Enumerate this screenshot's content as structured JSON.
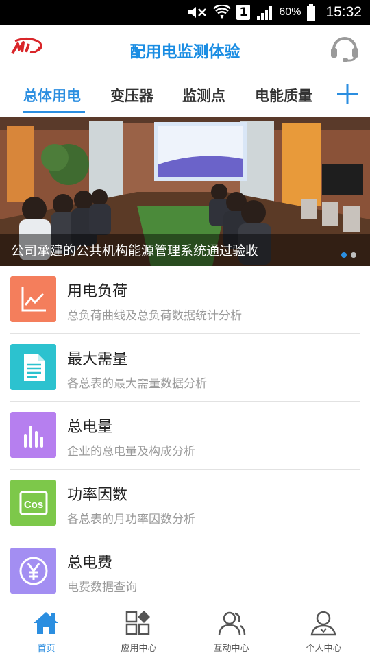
{
  "status_bar": {
    "battery_text": "60%",
    "time": "15:32",
    "sim_label": "1",
    "icons": [
      "mute-icon",
      "wifi-icon",
      "sim-icon",
      "signal-icon",
      "battery-icon"
    ]
  },
  "header": {
    "title": "配用电监测体验",
    "logo_icon": "app-logo-icon",
    "service_icon": "customer-service-headset-icon"
  },
  "tabs": {
    "items": [
      {
        "label": "总体用电",
        "active": true
      },
      {
        "label": "变压器",
        "active": false
      },
      {
        "label": "监测点",
        "active": false
      },
      {
        "label": "电能质量",
        "active": false
      }
    ],
    "add_icon": "plus-icon"
  },
  "banner": {
    "caption": "公司承建的公共机构能源管理系统通过验收",
    "slide_count": 2,
    "active_slide": 1
  },
  "list": {
    "items": [
      {
        "title": "用电负荷",
        "desc": "总负荷曲线及总负荷数据统计分析",
        "icon": "line-chart-icon",
        "color": "#f47e5c"
      },
      {
        "title": "最大需量",
        "desc": "各总表的最大需量数据分析",
        "icon": "document-icon",
        "color": "#2cc2cf"
      },
      {
        "title": "总电量",
        "desc": "企业的总电量及构成分析",
        "icon": "bar-chart-icon",
        "color": "#b67fef"
      },
      {
        "title": "功率因数",
        "desc": "各总表的月功率因数分析",
        "icon": "cos-icon",
        "color": "#7dc84a"
      },
      {
        "title": "总电费",
        "desc": "电费数据查询",
        "icon": "yen-icon",
        "color": "#a38ef2"
      }
    ]
  },
  "bottom_nav": {
    "items": [
      {
        "label": "首页",
        "icon": "home-icon",
        "active": true
      },
      {
        "label": "应用中心",
        "icon": "apps-grid-icon",
        "active": false
      },
      {
        "label": "互动中心",
        "icon": "users-icon",
        "active": false
      },
      {
        "label": "个人中心",
        "icon": "person-icon",
        "active": false
      }
    ]
  },
  "colors": {
    "accent": "#2b8ee0",
    "title": "#1a8de3",
    "status_bar_bg": "#000000"
  }
}
